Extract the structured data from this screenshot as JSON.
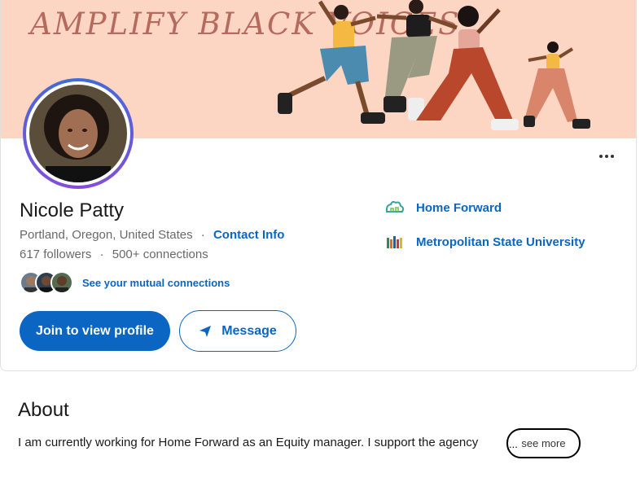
{
  "banner": {
    "text": "Amplify Black Voices"
  },
  "profile": {
    "name": "Nicole Patty",
    "location": "Portland, Oregon, United States",
    "separator": "·",
    "contact_info": "Contact Info",
    "followers": "617 followers",
    "connections": "500+ connections",
    "mutual_connections": "See your mutual connections"
  },
  "actions": {
    "join_label": "Join to view profile",
    "message_label": "Message"
  },
  "organizations": [
    {
      "name": "Home Forward",
      "icon": "home-forward-logo"
    },
    {
      "name": "Metropolitan State University",
      "icon": "metro-state-logo"
    }
  ],
  "about": {
    "title": "About",
    "text": "I am currently working for Home Forward as an Equity manager. I support the agency",
    "see_more": "see more"
  },
  "colors": {
    "accent": "#0a66c2",
    "banner": "#fcd5c3"
  }
}
